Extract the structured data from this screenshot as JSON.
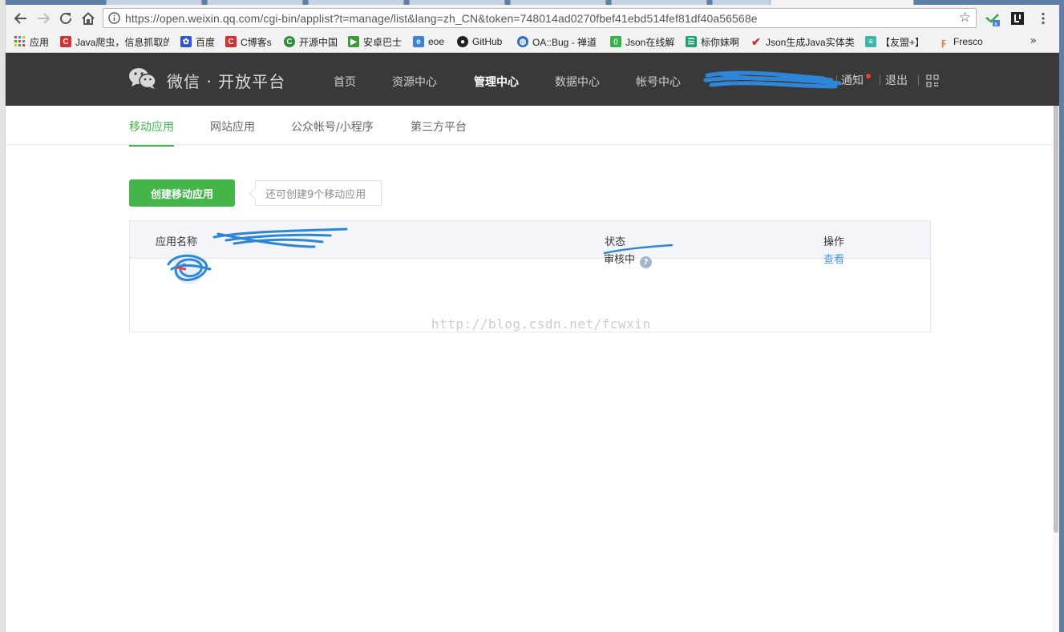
{
  "browser": {
    "url": "https://open.weixin.qq.com/cgi-bin/applist?t=manage/list&lang=zh_CN&token=748014ad0270fbef41ebd514fef81df40a56568e",
    "bookmarks": [
      {
        "label": "应用",
        "icon": "apps-grid-icon",
        "color": "#888888"
      },
      {
        "label": "Java爬虫，信息抓取的",
        "icon": "csdn-c-icon",
        "color": "#d83030"
      },
      {
        "label": "百度",
        "icon": "baidu-paw-icon",
        "color": "#2f54d6"
      },
      {
        "label": "C博客s",
        "icon": "csdn-c-icon",
        "color": "#d83030"
      },
      {
        "label": "开源中国",
        "icon": "oschina-icon",
        "color": "#2e8b3a"
      },
      {
        "label": "安卓巴士",
        "icon": "anzhuo-icon",
        "color": "#3a9a3a"
      },
      {
        "label": "eoe",
        "icon": "eoe-icon",
        "color": "#3a84d6"
      },
      {
        "label": "GitHub",
        "icon": "github-icon",
        "color": "#222222"
      },
      {
        "label": "OA::Bug - 禅道",
        "icon": "globe-icon",
        "color": "#2b6cc4"
      },
      {
        "label": "Json在线解",
        "icon": "json-icon",
        "color": "#35b24a"
      },
      {
        "label": "标你妹啊",
        "icon": "biaonimei-icon",
        "color": "#1aa373"
      },
      {
        "label": "Json生成Java实体类",
        "icon": "check-icon",
        "color": "#d12c2c"
      },
      {
        "label": "【友盟+】",
        "icon": "umeng-icon",
        "color": "#3bb7a8"
      },
      {
        "label": "Fresco",
        "icon": "fresco-icon",
        "color": "#e27a32"
      }
    ],
    "more": "»"
  },
  "header": {
    "brand": "微信 · 开放平台",
    "nav": [
      {
        "label": "首页",
        "active": false
      },
      {
        "label": "资源中心",
        "active": false
      },
      {
        "label": "管理中心",
        "active": true
      },
      {
        "label": "数据中心",
        "active": false
      },
      {
        "label": "帐号中心",
        "active": false
      }
    ],
    "notify": "通知",
    "logout": "退出"
  },
  "subnav": {
    "tabs": [
      {
        "label": "移动应用",
        "active": true
      },
      {
        "label": "网站应用",
        "active": false
      },
      {
        "label": "公众帐号/小程序",
        "active": false
      },
      {
        "label": "第三方平台",
        "active": false
      }
    ]
  },
  "main": {
    "create_button": "创建移动应用",
    "tip": "还可创建9个移动应用",
    "table": {
      "headers": [
        "应用名称",
        "状态",
        "操作"
      ],
      "rows": [
        {
          "status": "审核中",
          "action": "查看",
          "help": "?"
        }
      ]
    },
    "watermark": "http://blog.csdn.net/fcwxin"
  },
  "colors": {
    "accent_green": "#44b549",
    "topbar": "#393939",
    "link_blue": "#459ae9",
    "scribble_blue": "#2f86d9"
  }
}
